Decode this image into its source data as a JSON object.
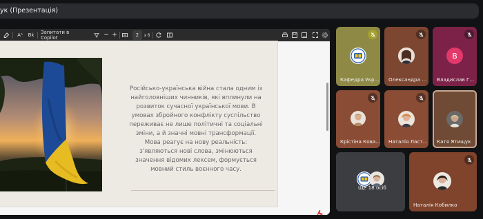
{
  "header": {
    "title": "ук (Презентація)"
  },
  "pdf_toolbar": {
    "font_label": "Aᴬ",
    "read_label": "Bk",
    "copilot_label": "Запитати в Copilot",
    "minus_label": "−",
    "plus_label": "+",
    "page_value": "2",
    "page_total": "з 6"
  },
  "slide": {
    "body_text": "Російсько-українська війна стала одним із найголовніших чинників, які вплинули на розвиток сучасної української мови. В умовах збройного конфлікту суспільство переживає не лише політичні та соціальні зміни, а й значні мовні трансформації. Мова реагує на нову реальність: з'являються нові слова, змінюються значення відомих лексем, формується мовний стиль воєнного часу."
  },
  "participants": [
    {
      "name": "Кафедра Укр...",
      "muted": true,
      "tile_color": "#8e8a45"
    },
    {
      "name": "Олександра ...",
      "muted": true,
      "tile_color": "#7d4630"
    },
    {
      "name": "Владислав Г...",
      "muted": true,
      "tile_color": "#7c2248",
      "avatar_letter": "В",
      "avatar_color": "#e3386a"
    },
    {
      "name": "Крістіна Кова...",
      "muted": true,
      "tile_color": "#8a4c34"
    },
    {
      "name": "Наталія Ласт...",
      "muted": true,
      "tile_color": "#8a4c34"
    },
    {
      "name": "Катя Ятищук",
      "muted": true,
      "tile_color": "#6f4a34",
      "active_speaker": true
    },
    {
      "name": "Наталія Кобилко",
      "muted": true,
      "tile_color": "#80432c"
    }
  ],
  "others_tile": {
    "label": "Ще 18 осіб",
    "tile_color": "#3b3d40"
  },
  "colors": {
    "accent_blue": "#4a93ff",
    "pdf_red": "#d93025",
    "flag_blue": "#1c4a96",
    "flag_yellow": "#f1c21f"
  }
}
